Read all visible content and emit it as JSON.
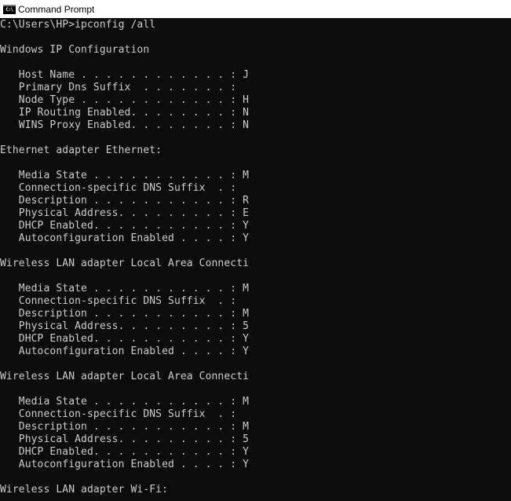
{
  "window": {
    "title": "Command Prompt",
    "icon": "cmd-icon",
    "icon_glyph": "C:\\"
  },
  "console": {
    "prompt": "C:\\Users\\HP>ipconfig /all",
    "header": "Windows IP Configuration",
    "global": [
      "   Host Name . . . . . . . . . . . . : J",
      "   Primary Dns Suffix  . . . . . . . :",
      "   Node Type . . . . . . . . . . . . : H",
      "   IP Routing Enabled. . . . . . . . : N",
      "   WINS Proxy Enabled. . . . . . . . : N"
    ],
    "adapters": [
      {
        "title": "Ethernet adapter Ethernet:",
        "lines": [
          "   Media State . . . . . . . . . . . : M",
          "   Connection-specific DNS Suffix  . :",
          "   Description . . . . . . . . . . . : R",
          "   Physical Address. . . . . . . . . : E",
          "   DHCP Enabled. . . . . . . . . . . : Y",
          "   Autoconfiguration Enabled . . . . : Y"
        ]
      },
      {
        "title": "Wireless LAN adapter Local Area Connecti",
        "lines": [
          "   Media State . . . . . . . . . . . : M",
          "   Connection-specific DNS Suffix  . :",
          "   Description . . . . . . . . . . . : M",
          "   Physical Address. . . . . . . . . : 5",
          "   DHCP Enabled. . . . . . . . . . . : Y",
          "   Autoconfiguration Enabled . . . . : Y"
        ]
      },
      {
        "title": "Wireless LAN adapter Local Area Connecti",
        "lines": [
          "   Media State . . . . . . . . . . . : M",
          "   Connection-specific DNS Suffix  . :",
          "   Description . . . . . . . . . . . : M",
          "   Physical Address. . . . . . . . . : 5",
          "   DHCP Enabled. . . . . . . . . . . : Y",
          "   Autoconfiguration Enabled . . . . : Y"
        ]
      },
      {
        "title": "Wireless LAN adapter Wi-Fi:",
        "lines": []
      }
    ]
  },
  "colors": {
    "console_bg": "#0c0c0c",
    "console_fg": "#cccccc",
    "titlebar_bg": "#ffffff"
  }
}
